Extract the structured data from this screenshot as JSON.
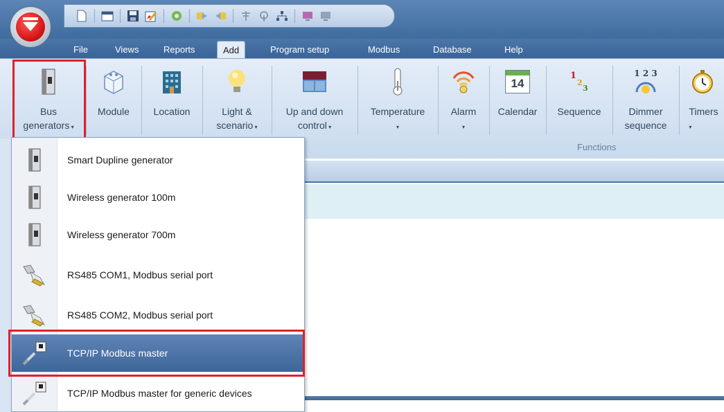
{
  "app": {
    "logo": "carlo-gavazzi-logo",
    "quick_access": [
      "new-icon",
      "open-icon",
      "save-icon",
      "edit-icon",
      "settings-icon",
      "import-icon",
      "export-icon",
      "antenna-icon",
      "wireless-icon",
      "network-icon",
      "monitor-icon",
      "screen-icon"
    ]
  },
  "menu": {
    "tabs": [
      "File",
      "Views",
      "Reports",
      "Add",
      "Program setup",
      "Modbus",
      "Database",
      "Help"
    ],
    "active": "Add"
  },
  "ribbon": {
    "buttons": [
      {
        "label": "Bus generators",
        "line1": "Bus",
        "line2": "generators",
        "dropdown": true,
        "icon": "bus-generator-icon"
      },
      {
        "label": "Module",
        "line1": "Module",
        "line2": "",
        "dropdown": false,
        "icon": "module-icon"
      },
      {
        "label": "Location",
        "line1": "Location",
        "line2": "",
        "dropdown": false,
        "icon": "building-icon"
      },
      {
        "label": "Light & scenario",
        "line1": "Light &",
        "line2": "scenario",
        "dropdown": true,
        "icon": "lightbulb-icon"
      },
      {
        "label": "Up and down control",
        "line1": "Up and down",
        "line2": "control",
        "dropdown": true,
        "icon": "blind-icon"
      },
      {
        "label": "Temperature",
        "line1": "Temperature",
        "line2": "",
        "dropdown": true,
        "icon": "thermometer-icon"
      },
      {
        "label": "Alarm",
        "line1": "Alarm",
        "line2": "",
        "dropdown": true,
        "icon": "alarm-icon"
      },
      {
        "label": "Calendar",
        "line1": "Calendar",
        "line2": "",
        "dropdown": false,
        "icon": "calendar-icon",
        "calendar_day": "14"
      },
      {
        "label": "Sequence",
        "line1": "Sequence",
        "line2": "",
        "dropdown": false,
        "icon": "sequence-icon"
      },
      {
        "label": "Dimmer sequence",
        "line1": "Dimmer",
        "line2": "sequence",
        "dropdown": false,
        "icon": "dimmer-sequence-icon",
        "digits": "1 2 3"
      },
      {
        "label": "Timers",
        "line1": "Timers",
        "line2": "",
        "dropdown": true,
        "icon": "timer-icon"
      }
    ],
    "group_label": "Functions"
  },
  "dropdown": {
    "items": [
      {
        "label": "Smart Dupline generator",
        "icon": "bus-generator-icon"
      },
      {
        "label": "Wireless generator 100m",
        "icon": "bus-generator-icon"
      },
      {
        "label": "Wireless generator 700m",
        "icon": "bus-generator-icon"
      },
      {
        "label": "RS485 COM1, Modbus serial port",
        "icon": "serial-port-icon"
      },
      {
        "label": "RS485 COM2, Modbus serial port",
        "icon": "serial-port-icon"
      },
      {
        "label": "TCP/IP Modbus master",
        "icon": "ethernet-icon"
      },
      {
        "label": "TCP/IP Modbus master for generic devices",
        "icon": "ethernet-icon"
      }
    ],
    "selected_index": 5
  },
  "colors": {
    "highlight": "#e0202a",
    "selected_bg": "#4d74a8",
    "ribbon_bg": "#d6e3f2"
  }
}
